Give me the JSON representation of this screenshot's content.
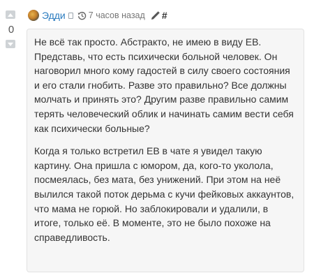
{
  "comment": {
    "author": "Эдди",
    "timestamp": "7 часов назад",
    "anchor": "#",
    "votes": "0",
    "paragraphs": [
      "Не всё так просто. Абстракто, не имею в виду ЕВ. Представь, что есть психически больной человек. Он наговорил много кому гадостей в силу своего состояния и его стали гнобить. Разве это правильно? Все должны молчать и принять это? Другим разве правильно самим терять человеческий облик и начинать самим вести себя как психически больные?",
      "Когда я только встретил ЕВ в чате я увидел такую картину. Она пришла с юмором, да, кого-то уколола, посмеялась, без мата, без унижений. При этом на неё вылился такой поток дерьма с кучи фейковых аккаунтов, что мама не горюй. Но заблокировали и удалили, в итоге, только её. В моменте, это не было похоже на справедливость."
    ]
  },
  "icons": {
    "upvote": "arrow-up-icon",
    "downvote": "arrow-down-icon",
    "time": "clock-history-icon",
    "edit": "pencil-icon",
    "author_badge": "badge-icon"
  },
  "colors": {
    "author_link": "#2a7bbf",
    "vote_button": "#cfd3d6",
    "bubble_bg": "#f6f6f6",
    "text": "#333333"
  }
}
